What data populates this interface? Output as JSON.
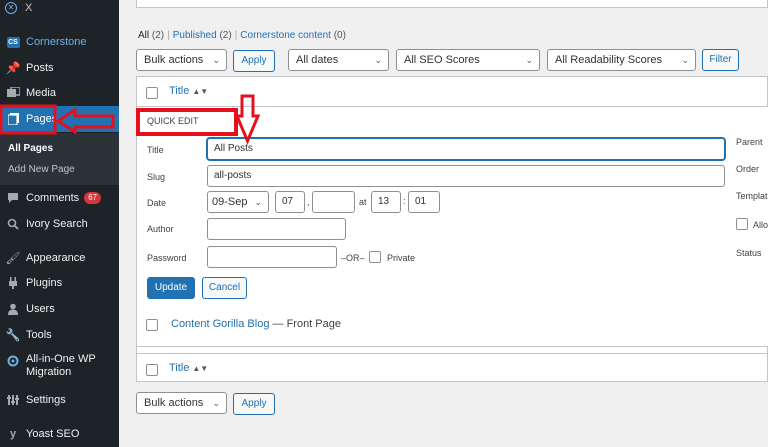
{
  "sidebar": {
    "close_label": "X",
    "items": [
      {
        "label": "Cornerstone",
        "icon": "cornerstone-icon"
      },
      {
        "label": "Posts",
        "icon": "pushpin-icon"
      },
      {
        "label": "Media",
        "icon": "media-icon"
      },
      {
        "label": "Pages",
        "icon": "pages-icon"
      },
      {
        "label": "Comments",
        "icon": "comment-icon",
        "badge": "67"
      },
      {
        "label": "Ivory Search",
        "icon": "search-icon"
      },
      {
        "label": "Appearance",
        "icon": "paintbrush-icon"
      },
      {
        "label": "Plugins",
        "icon": "plugin-icon"
      },
      {
        "label": "Users",
        "icon": "user-icon"
      },
      {
        "label": "Tools",
        "icon": "wrench-icon"
      },
      {
        "label": "All-in-One WP Migration",
        "icon": "migration-icon"
      },
      {
        "label": "Settings",
        "icon": "settings-icon"
      },
      {
        "label": "Yoast SEO",
        "icon": "yoast-icon"
      }
    ],
    "submenu": [
      "All Pages",
      "Add New Page"
    ],
    "accent": "#2271b1"
  },
  "filters": {
    "views": {
      "all": "All",
      "all_count": "(2)",
      "published": "Published",
      "published_count": "(2)",
      "cornerstone": "Cornerstone content",
      "cornerstone_count": "(0)"
    },
    "bulk_actions": "Bulk actions",
    "apply": "Apply",
    "dates": "All dates",
    "seo": "All SEO Scores",
    "readability": "All Readability Scores",
    "filter": "Filter"
  },
  "table": {
    "col_title": "Title",
    "quick_edit": {
      "heading": "QUICK EDIT",
      "title_label": "Title",
      "title_value": "All Posts",
      "slug_label": "Slug",
      "slug_value": "all-posts",
      "date_label": "Date",
      "month": "09-Sep",
      "day": "07",
      "year": "",
      "at": "at",
      "hour": "13",
      "minute": "01",
      "author_label": "Author",
      "author_value": "",
      "password_label": "Password",
      "password_value": "",
      "or_text": "–OR–",
      "private_label": "Private",
      "update": "Update",
      "cancel": "Cancel",
      "parent_label": "Parent",
      "order_label": "Order",
      "template_label": "Templat",
      "allow_label": "Allo",
      "status_label": "Status"
    },
    "row": {
      "title": "Content Gorilla Blog",
      "state": " — Front Page"
    }
  },
  "bottom": {
    "bulk_actions": "Bulk actions",
    "apply": "Apply"
  },
  "annotation_color": "#e5101c"
}
